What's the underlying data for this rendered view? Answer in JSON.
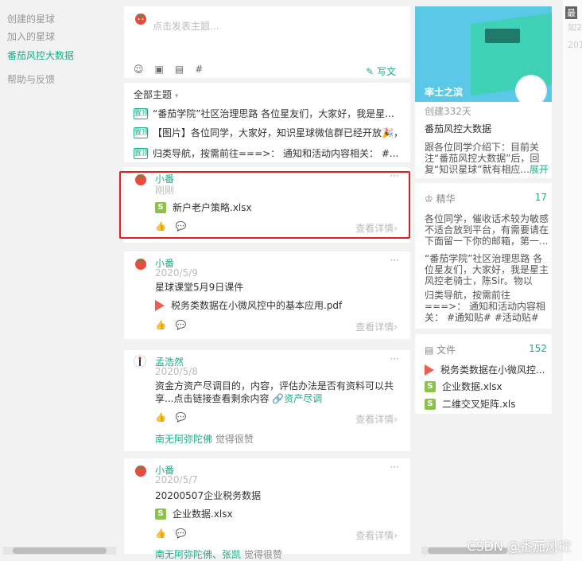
{
  "sidebar": {
    "items": [
      {
        "label": "创建的星球",
        "active": false
      },
      {
        "label": "加入的星球",
        "active": false
      },
      {
        "label": "番茄风控大数据",
        "active": true
      },
      {
        "label": "帮助与反馈",
        "active": false
      }
    ]
  },
  "compose": {
    "placeholder": "点击发表主题...",
    "tools": [
      "☺",
      "▣",
      "▤",
      "#"
    ],
    "write_label": "写文"
  },
  "pinned": {
    "header": "全部主题",
    "tag": "置顶",
    "items": [
      "“番茄学院”社区治理思路 各位星友们，大家好，我是星...",
      "【图片】各位同学，大家好，知识星球微信群已经开放🎉，",
      "归类导航，按需前往===>： 通知和活动内容相关： #..."
    ]
  },
  "posts": [
    {
      "author": "小番",
      "time": "刚刚",
      "text": "",
      "file": {
        "type": "xls",
        "name": "新户老户策略.xlsx"
      },
      "detail": "查看详情",
      "likes": ""
    },
    {
      "author": "小番",
      "time": "2020/5/9",
      "text": "星球课堂5月9日课件",
      "file": {
        "type": "pdf",
        "name": "税务类数据在小微风控中的基本应用.pdf"
      },
      "detail": "查看详情",
      "likes": ""
    },
    {
      "author": "孟浩然",
      "time": "2020/5/8",
      "text": "资金方资产尽调目的，内容，评估办法是否有资料可以共享...点击链接查看剩余内容",
      "link": "资产尽调",
      "detail": "查看详情",
      "likes": "南无阿弥陀佛",
      "likes_suffix": "觉得很赞"
    },
    {
      "author": "小番",
      "time": "2020/5/7",
      "text": "20200507企业税务数据",
      "file": {
        "type": "xls",
        "name": "企业数据.xlsx"
      },
      "detail": "查看详情",
      "likes": "南无阿弥陀佛、张凯",
      "likes_suffix": "觉得很赞"
    }
  ],
  "group": {
    "name": "率士之滨",
    "created": "创建332天",
    "title": "番茄风控大数据",
    "desc": "跟各位同学介绍下：目前关注“番茄风控大数据”后，回复“知识星球”就有相应...",
    "expand": "展开"
  },
  "digest": {
    "header": "精华",
    "count": "17",
    "items": [
      "各位同学，催收话术较为敏感不适合放到平台，有需要请在下面留一下你的邮箱，第一...",
      "“番茄学院”社区治理思路 各位星友们，大家好，我是星主风控老骑士，陈Sir。物以类...",
      "归类导航，按需前往===>： 通知和活动内容相关： #通知贴# #活动贴# 提问类型：..."
    ]
  },
  "files": {
    "header": "文件",
    "count": "152",
    "items": [
      {
        "type": "pdf",
        "name": "税务类数据在小微风控..."
      },
      {
        "type": "xls",
        "name": "企业数据.xlsx"
      },
      {
        "type": "xls",
        "name": "二维交叉矩阵.xls"
      }
    ]
  },
  "farright": {
    "caption": "最",
    "texts": [
      "如2",
      "201"
    ]
  },
  "watermark": "CSDN @番茄风控",
  "colors": {
    "accent": "#1fab89",
    "highlight": "#e02020"
  }
}
